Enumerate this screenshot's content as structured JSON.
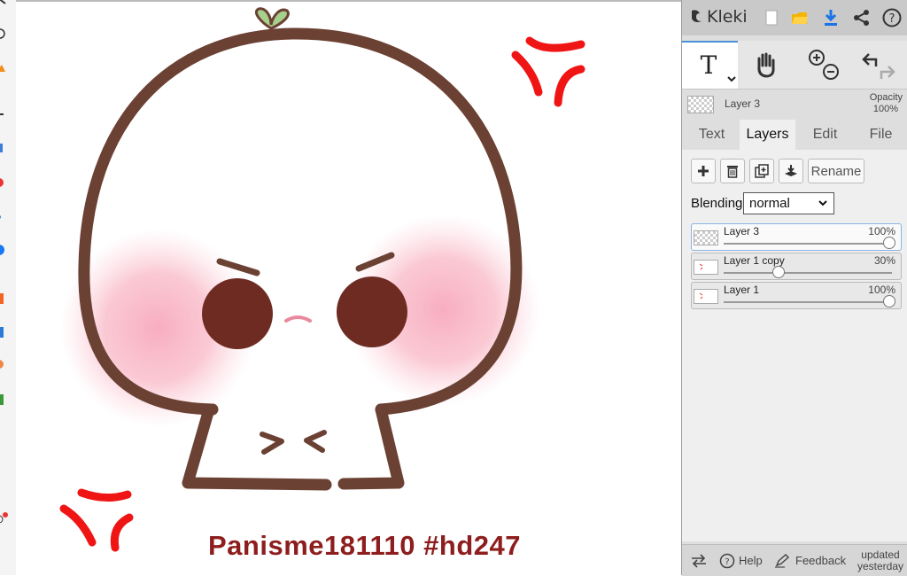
{
  "canvas": {
    "watermark": "Panisme181110  #hd247"
  },
  "app": {
    "brand_name": "Kleki",
    "toolbar_icons": [
      "new-file-icon",
      "open-folder-icon",
      "download-icon",
      "share-icon",
      "help-icon"
    ]
  },
  "tools": [
    {
      "name": "text-tool",
      "active": true
    },
    {
      "name": "hand-tool",
      "active": false
    },
    {
      "name": "zoom-tool",
      "active": false
    },
    {
      "name": "undo-redo",
      "active": false
    }
  ],
  "current_layer": {
    "name": "Layer 3",
    "opacity_label": "Opacity",
    "opacity_value": "100%"
  },
  "tabs": [
    "Text",
    "Layers",
    "Edit",
    "File"
  ],
  "active_tab": "Layers",
  "layers_panel": {
    "rename_label": "Rename",
    "blending_label": "Blending",
    "blending_value": "normal",
    "layers": [
      {
        "name": "Layer 3",
        "opacity": "100%",
        "opacity_fraction": 1.0,
        "selected": true
      },
      {
        "name": "Layer 1 copy",
        "opacity": "30%",
        "opacity_fraction": 0.3,
        "selected": false
      },
      {
        "name": "Layer 1",
        "opacity": "100%",
        "opacity_fraction": 1.0,
        "selected": false
      }
    ]
  },
  "bottom": {
    "help_label": "Help",
    "feedback_label": "Feedback",
    "updated_line1": "updated",
    "updated_line2": "yesterday"
  },
  "colors": {
    "outline_brown": "#6b4133",
    "eye_brown": "#6e2b22",
    "blush_pink": "#f7a9bd",
    "anger_red": "#f01515",
    "sprout_green": "#a8d08d",
    "accent_blue": "#1a73e8"
  }
}
